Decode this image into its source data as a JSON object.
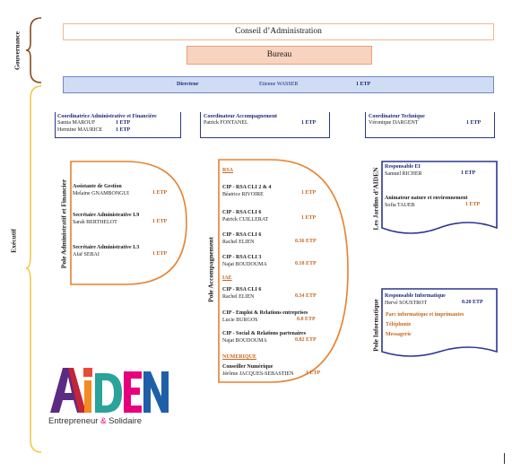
{
  "gouvernance": {
    "label": "Gouvernance",
    "conseil": "Conseil d’Administration",
    "bureau": "Bureau",
    "directeur": {
      "title": "Directeur",
      "name": "Etienne WASSER",
      "etp": "1 ETP"
    }
  },
  "executif": {
    "label": "Exécutif"
  },
  "coordinators": [
    {
      "title": "Coordinatrice Administrative et Financière",
      "people": [
        {
          "name": "Samia MAROUF",
          "etp": "1 ETP"
        },
        {
          "name": "Hermine MAURICE",
          "etp": "1 ETP"
        }
      ]
    },
    {
      "title": "Coordinateur Accompagnement",
      "people": [
        {
          "name": "Patrick FONTANEL",
          "etp": "1 ETP"
        }
      ]
    },
    {
      "title": "Coordinateur Technique",
      "people": [
        {
          "name": "Véronique DARGENT",
          "etp": "1 ETP"
        }
      ]
    }
  ],
  "pole_admin": {
    "label": "Pole Administratif et Financier",
    "roles": [
      {
        "title": "Assistante de Gestion",
        "name": "Melaine GNAMBONGUI",
        "etp": "1 ETP"
      },
      {
        "title": "Secrétaire Administrative L9",
        "name": "Sarah BERTHELOT",
        "etp": "1 ETP"
      },
      {
        "title": "Secrétaire Administrative L3",
        "name": "Afaf SEBAI",
        "etp": "1 ETP"
      }
    ]
  },
  "pole_accomp": {
    "label": "Pole Accompagnement",
    "rsa_heading": "RSA",
    "rsa": [
      {
        "title": "CIP - RSA CLI 2 & 4",
        "name": "Béatrice RIVOIRE",
        "etp": "1 ETP"
      },
      {
        "title": "CIP - RSA CLI 6",
        "name": "Patrick CUILLERAT",
        "etp": "1 ETP"
      },
      {
        "title": "CIP - RSA CLI 6",
        "name": "Rachel ELIEN",
        "etp": "0.36 ETP"
      },
      {
        "title": "CIP - RSA CLI 3",
        "name": "Najat BOUDOUMA",
        "etp": "0.18 ETP"
      }
    ],
    "iae_heading": "IAE",
    "iae": [
      {
        "title": "CIP - RSA CLI 6",
        "name": "Rachel ELIEN",
        "etp": "0.34 ETP"
      },
      {
        "title": "CIP - Emploi & Relations entreprises",
        "name": "Lucie BURGOS",
        "etp": "0.8 ETP"
      },
      {
        "title": "CIP - Social & Relations partenaires",
        "name": "Najat BOUDOUMA",
        "etp": "0.82 ETP"
      }
    ],
    "num_heading": "NUMERIQUE",
    "num": [
      {
        "title": "Conseiller Numérique",
        "name": "Jérôme JACQUES-SEBASTIEN",
        "etp": "1 ETP"
      }
    ]
  },
  "jardins": {
    "label": "Les Jardins d’AIDEN",
    "roles": [
      {
        "title": "Responsable EI",
        "name": "Samuel RICHER",
        "etp": "1 ETP"
      },
      {
        "title": "Animateur nature et environnement",
        "name": "Sofia TAUEB",
        "etp": "1 ETP"
      }
    ]
  },
  "pole_info": {
    "label": "Pole Informatique",
    "title": "Responsable Informatique",
    "name": "Hervé SOUSTROT",
    "etp": "0.20 ETP",
    "tasks": [
      "Parc informatique et imprimantes",
      "Téléphonie",
      "Messagerie"
    ]
  },
  "logo": {
    "text": "AIDEN",
    "tagline_a": "Entrepreneur",
    "tagline_amp": "&",
    "tagline_b": "Solidaire"
  },
  "colors": {
    "orange": "#e8802c",
    "navy": "#1f2a7a",
    "bureau_fill": "#f8d3bf",
    "dir_fill": "#cfdcf4",
    "brown": "#8a4b1c",
    "yellow": "#f2c94c"
  }
}
